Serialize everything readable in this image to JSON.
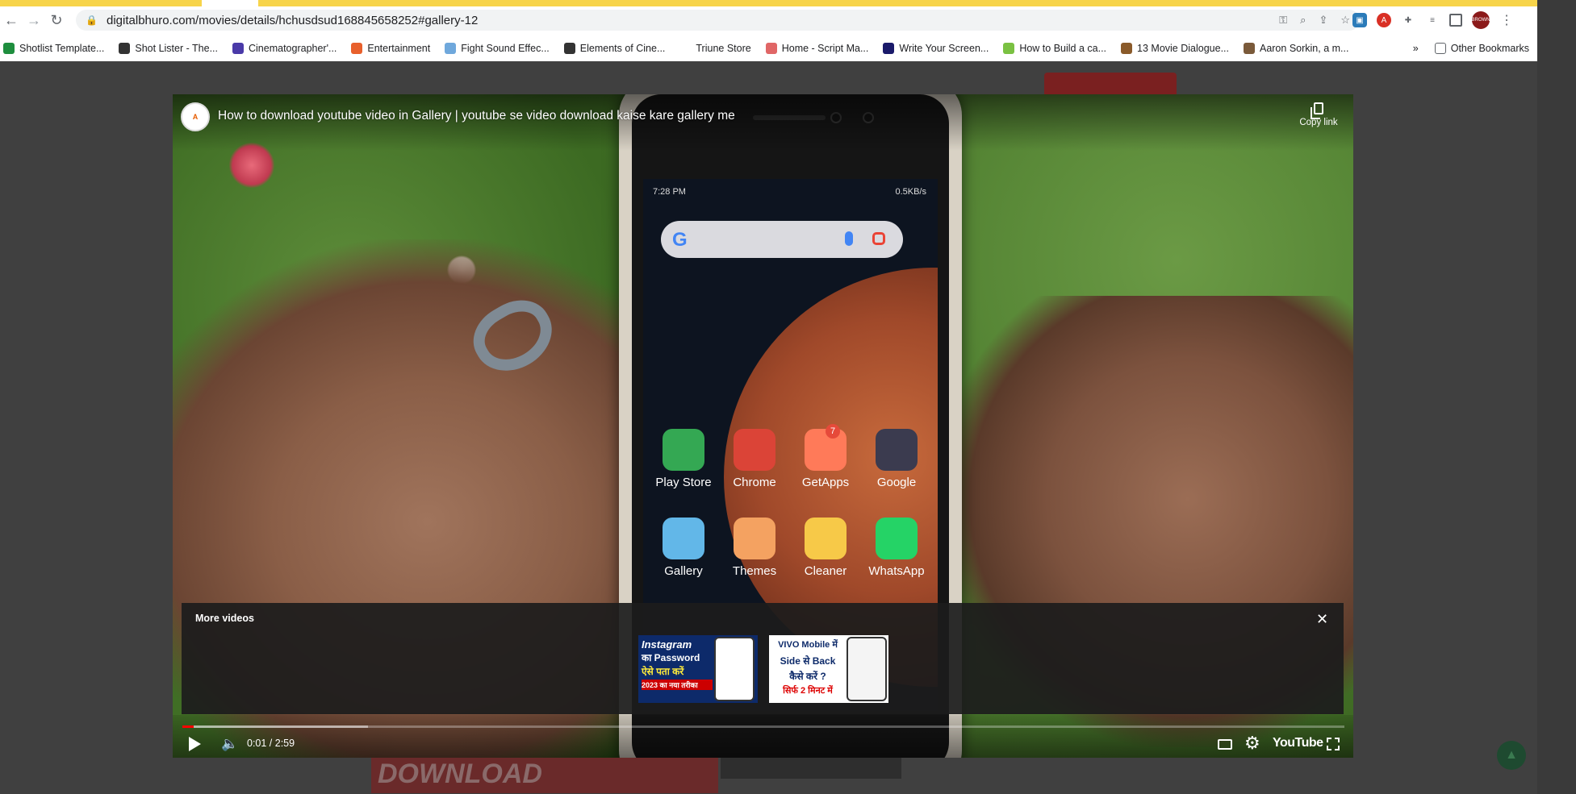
{
  "browser": {
    "url": "digitalbhuro.com/movies/details/hchusdsud168845658252#gallery-12",
    "profile_initials": "BROWN",
    "bookmarks": [
      {
        "label": "Shotlist Template...",
        "color": "#1e8e3e"
      },
      {
        "label": "Shot Lister - The...",
        "color": "#333333"
      },
      {
        "label": "Cinematographer'...",
        "color": "#4a3aa8"
      },
      {
        "label": "Entertainment",
        "color": "#e8602c"
      },
      {
        "label": "Fight Sound Effec...",
        "color": "#6fa8dc"
      },
      {
        "label": "Elements of Cine...",
        "color": "#333333"
      },
      {
        "label": "Triune Store",
        "color": "#ffffff"
      },
      {
        "label": "Home - Script Ma...",
        "color": "#e06666"
      },
      {
        "label": "Write Your Screen...",
        "color": "#1a1a6a"
      },
      {
        "label": "How to Build a ca...",
        "color": "#7ac142"
      },
      {
        "label": "13 Movie Dialogue...",
        "color": "#8a5a2a"
      },
      {
        "label": "Aaron Sorkin, a m...",
        "color": "#7a5a3a"
      }
    ],
    "bookmarks_overflow": "»",
    "other_bookmarks": "Other Bookmarks"
  },
  "page": {
    "download_banner": "DOWNLOAD"
  },
  "player": {
    "video_title": "How to download youtube video in Gallery | youtube se video download kaise kare gallery me",
    "channel_avatar_text": "A",
    "copy_link_label": "Copy link",
    "more_videos_label": "More videos",
    "more_videos_close": "✕",
    "thumbnails": [
      {
        "lines": [
          "Instagram",
          "का Password",
          "ऐसे पता करें",
          "2023 का नया तरीका"
        ]
      },
      {
        "lines": [
          "VIVO Mobile में",
          "Side से Back",
          "कैसे करें ?",
          "सिर्फ 2 मिनट में"
        ]
      }
    ],
    "time": "0:01 / 2:59",
    "progress_played_pct": 1,
    "progress_loaded_pct": 16,
    "youtube_logo": "YouTube"
  },
  "phone_screen": {
    "status_time": "7:28 PM",
    "status_right": "0.5KB/s",
    "apps_row1": [
      {
        "label": "Play Store",
        "color": "#34a853"
      },
      {
        "label": "Chrome",
        "color": "#db4437"
      },
      {
        "label": "GetApps",
        "color": "#ff7a59",
        "badge": "7"
      },
      {
        "label": "Google",
        "color": "#3b3b4f"
      }
    ],
    "apps_row2": [
      {
        "label": "Gallery",
        "color": "#62b7e8"
      },
      {
        "label": "Themes",
        "color": "#f4a261"
      },
      {
        "label": "Cleaner",
        "color": "#f7c948"
      },
      {
        "label": "WhatsApp",
        "color": "#25d366"
      }
    ]
  }
}
